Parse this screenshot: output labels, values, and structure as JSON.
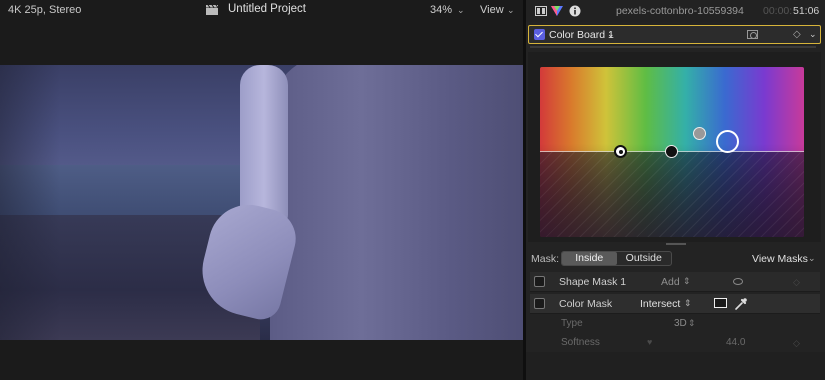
{
  "viewer": {
    "format": "4K 25p, Stereo",
    "project_title": "Untitled Project",
    "zoom": "34%",
    "view_menu": "View",
    "chevron": "⌄"
  },
  "inspector": {
    "clip_name": "pexels-cottonbro-10559394",
    "timecode_dim": "00:00:",
    "timecode": "51:06",
    "effect_name": "Color Board 1",
    "chevron": "⌄",
    "keyframe_glyph": "◇"
  },
  "mask": {
    "label": "Mask:",
    "segments": [
      "Inside",
      "Outside"
    ],
    "selected": "Inside",
    "view_masks": "View Masks",
    "shape_mask": {
      "name": "Shape Mask 1",
      "mode": "Add",
      "updown": "⌃"
    },
    "color_mask": {
      "name": "Color Mask",
      "mode": "Intersect"
    },
    "params": {
      "type_label": "Type",
      "type_value": "3D",
      "softness_label": "Softness",
      "softness_value": "44.0"
    }
  },
  "colors": {
    "accent": "#5b5fe0",
    "selection_border": "#d7b43a",
    "panel_bg": "#232323"
  },
  "icons": [
    "clapperboard-icon",
    "film-icon",
    "color-triangle-icon",
    "info-icon",
    "mask-shape-icon",
    "keyframe-icon",
    "oval-icon",
    "eyedropper-icon"
  ]
}
